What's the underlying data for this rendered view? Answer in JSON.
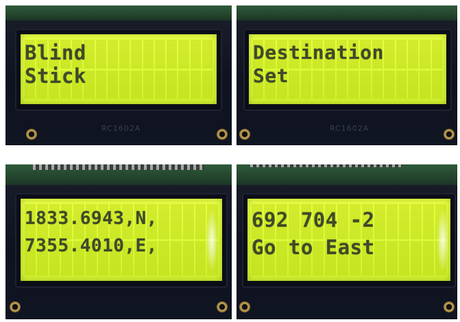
{
  "panels": [
    {
      "line1": "Blind",
      "line2": "Stick",
      "model_label": "RC1602A"
    },
    {
      "line1": "Destination",
      "line2": "Set",
      "model_label": "RC1602A"
    },
    {
      "line1": "1833.6943,N,",
      "line2": "7355.4010,E,",
      "model_label": ""
    },
    {
      "line1": "692 704 -2",
      "line2": "Go to East",
      "model_label": ""
    }
  ],
  "colors": {
    "lcd_backlight": "#dcf93a",
    "lcd_text": "#3f4a2a",
    "bezel": "#0b0e17",
    "pcb": "#2e5a3a"
  }
}
